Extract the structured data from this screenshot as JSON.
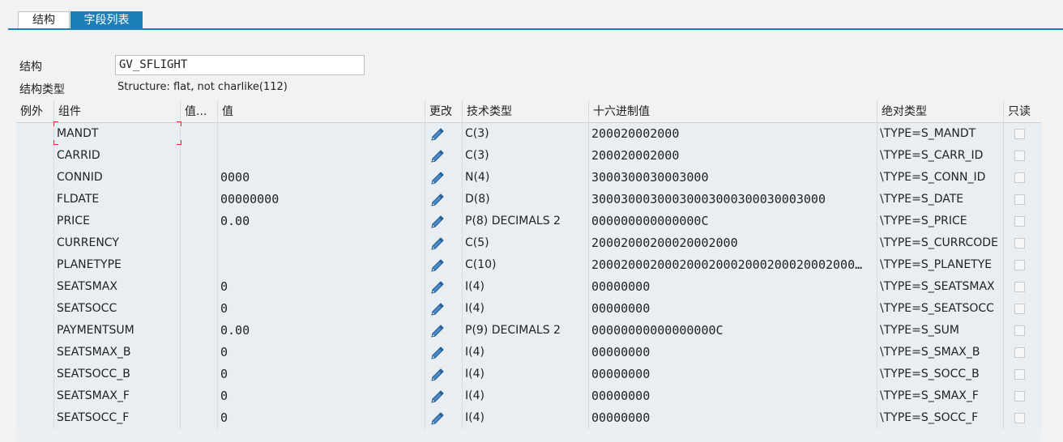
{
  "tabs": [
    {
      "label": "结构"
    },
    {
      "label": "字段列表"
    }
  ],
  "header": {
    "struct_label": "结构",
    "struct_value": "GV_SFLIGHT",
    "type_label": "结构类型",
    "type_value": "Structure: flat, not charlike(112)"
  },
  "columns": {
    "exception": "例外",
    "component": "组件",
    "value_short": "值...",
    "value": "值",
    "change": "更改",
    "tech_type": "技术类型",
    "hex": "十六进制值",
    "abs_type": "绝对类型",
    "readonly": "只读"
  },
  "rows": [
    {
      "component": "MANDT",
      "value": "",
      "tech": "C(3)",
      "hex": "200020002000",
      "abs": "\\TYPE=S_MANDT"
    },
    {
      "component": "CARRID",
      "value": "",
      "tech": "C(3)",
      "hex": "200020002000",
      "abs": "\\TYPE=S_CARR_ID"
    },
    {
      "component": "CONNID",
      "value": "0000",
      "tech": "N(4)",
      "hex": "3000300030003000",
      "abs": "\\TYPE=S_CONN_ID"
    },
    {
      "component": "FLDATE",
      "value": "00000000",
      "tech": "D(8)",
      "hex": "30003000300030003000300030003000",
      "abs": "\\TYPE=S_DATE"
    },
    {
      "component": "PRICE",
      "value": "0.00",
      "tech": "P(8) DECIMALS 2",
      "hex": "000000000000000C",
      "abs": "\\TYPE=S_PRICE"
    },
    {
      "component": "CURRENCY",
      "value": "",
      "tech": "C(5)",
      "hex": "20002000200020002000",
      "abs": "\\TYPE=S_CURRCODE"
    },
    {
      "component": "PLANETYPE",
      "value": "",
      "tech": "C(10)",
      "hex": "200020002000200020002000200020002000…",
      "abs": "\\TYPE=S_PLANETYE"
    },
    {
      "component": "SEATSMAX",
      "value": "0",
      "tech": "I(4)",
      "hex": "00000000",
      "abs": "\\TYPE=S_SEATSMAX"
    },
    {
      "component": "SEATSOCC",
      "value": "0",
      "tech": "I(4)",
      "hex": "00000000",
      "abs": "\\TYPE=S_SEATSOCC"
    },
    {
      "component": "PAYMENTSUM",
      "value": "0.00",
      "tech": "P(9) DECIMALS 2",
      "hex": "00000000000000000C",
      "abs": "\\TYPE=S_SUM"
    },
    {
      "component": "SEATSMAX_B",
      "value": "0",
      "tech": "I(4)",
      "hex": "00000000",
      "abs": "\\TYPE=S_SMAX_B"
    },
    {
      "component": "SEATSOCC_B",
      "value": "0",
      "tech": "I(4)",
      "hex": "00000000",
      "abs": "\\TYPE=S_SOCC_B"
    },
    {
      "component": "SEATSMAX_F",
      "value": "0",
      "tech": "I(4)",
      "hex": "00000000",
      "abs": "\\TYPE=S_SMAX_F"
    },
    {
      "component": "SEATSOCC_F",
      "value": "0",
      "tech": "I(4)",
      "hex": "00000000",
      "abs": "\\TYPE=S_SOCC_F"
    }
  ],
  "icons": {
    "edit": "pencil-icon",
    "readonly": "checkbox"
  },
  "colors": {
    "accent": "#1c7fb9",
    "grid_bg": "#e9eef2",
    "pencil": "#2f6fae"
  }
}
